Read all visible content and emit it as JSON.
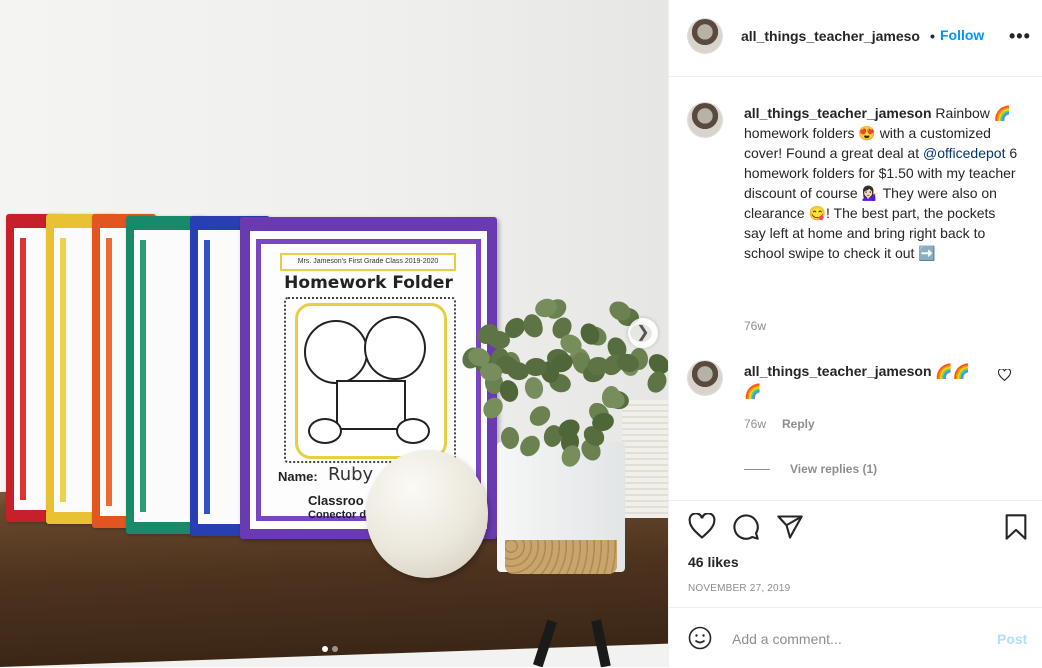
{
  "post": {
    "header": {
      "username": "all_things_teacher_jameso",
      "separator": "•",
      "follow_label": "Follow",
      "more_label": "•••"
    },
    "caption": {
      "username": "all_things_teacher_jameson",
      "text_parts": {
        "p1": " Rainbow 🌈 homework folders 😍 with a customized cover! Found a great deal at ",
        "mention": "@officedepot",
        "p2": " 6 homework folders for $1.50 with my teacher discount of course 💁🏻‍♀️ They were also on clearance 😋! The best part, the pockets say left at home and bring right back to school swipe to check it out ➡️"
      },
      "time": "76w"
    },
    "comment": {
      "username": "all_things_teacher_jameson",
      "text": " 🌈🌈🌈",
      "time": "76w",
      "reply_label": "Reply",
      "heart_icon": "heart-outline-icon"
    },
    "view_replies_label": "View replies (1)",
    "likes": "46 likes",
    "date": "NOVEMBER 27, 2019",
    "add_comment": {
      "placeholder": "Add a comment...",
      "post_label": "Post"
    },
    "photo": {
      "banner": "Mrs. Jameson's First Grade Class 2019-2020",
      "title": "Homework Folder",
      "name_label": "Name:",
      "name_value": "Ruby",
      "class_line1": "Classroo",
      "class_line2": "Conector d",
      "carousel_pages": 2,
      "carousel_current": 1
    },
    "colors": {
      "link": "#0095f6",
      "mention": "#00376b",
      "post_disabled": "#b2dffc",
      "muted": "#8e8e8e"
    }
  }
}
